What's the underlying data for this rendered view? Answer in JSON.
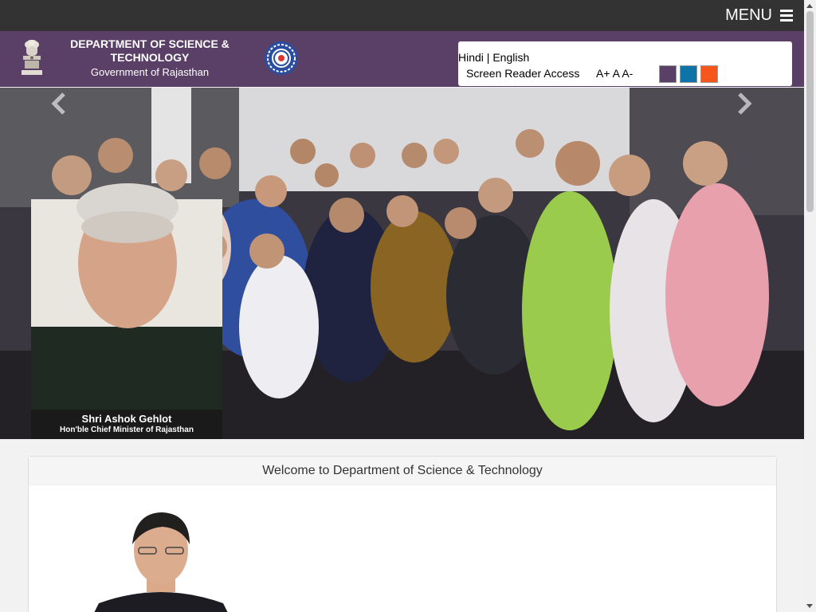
{
  "topbar": {
    "menu_label": "MENU"
  },
  "header": {
    "title": "DEPARTMENT OF SCIENCE & TECHNOLOGY",
    "subtitle": "Government of Rajasthan",
    "emblem_icon": "state-emblem-icon",
    "logo_icon": "dst-logo-icon"
  },
  "tools": {
    "lang_hindi": "Hindi",
    "lang_sep": "|",
    "lang_english": "English",
    "screen_reader": "Screen Reader Access",
    "font_larger": "A+",
    "font_normal": "A",
    "font_smaller": "A-",
    "themes": [
      "#5a3f66",
      "#0e74a8",
      "#f6561b"
    ]
  },
  "slider": {
    "caption_name": "Shri Ashok Gehlot",
    "caption_role": "Hon'ble Chief Minister of Rajasthan",
    "prev_icon": "chevron-left-icon",
    "next_icon": "chevron-right-icon"
  },
  "welcome": {
    "heading": "Welcome to Department of Science & Technology"
  },
  "colors": {
    "topbar": "#333333",
    "header": "#5a3f66",
    "page_bg": "#f2f2f2"
  }
}
